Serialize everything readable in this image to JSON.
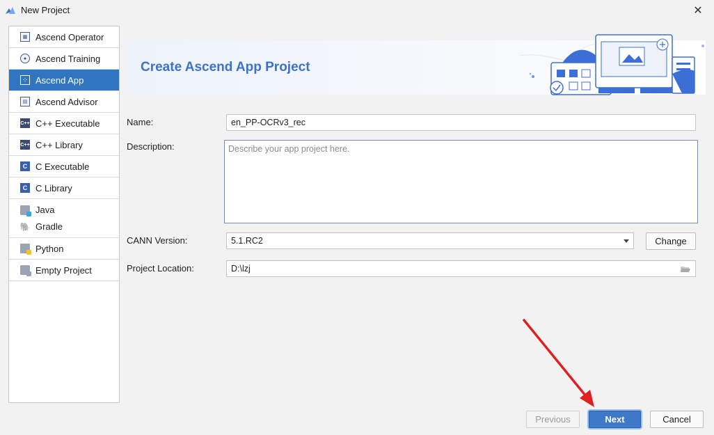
{
  "window": {
    "title": "New Project",
    "close_glyph": "✕"
  },
  "sidebar": {
    "items": [
      {
        "label": "Ascend Operator",
        "icon": "operator-icon",
        "selected": false
      },
      {
        "label": "Ascend Training",
        "icon": "training-icon",
        "selected": false
      },
      {
        "label": "Ascend App",
        "icon": "app-icon",
        "selected": true
      },
      {
        "label": "Ascend Advisor",
        "icon": "advisor-icon",
        "selected": false
      },
      {
        "label": "C++ Executable",
        "icon": "cpp-icon",
        "icon_text": "C++",
        "selected": false
      },
      {
        "label": "C++ Library",
        "icon": "cpp-icon",
        "icon_text": "C++",
        "selected": false
      },
      {
        "label": "C Executable",
        "icon": "c-icon",
        "icon_text": "C",
        "selected": false
      },
      {
        "label": "C Library",
        "icon": "c-icon",
        "icon_text": "C",
        "selected": false
      },
      {
        "label": "Java",
        "icon": "java-icon",
        "selected": false
      },
      {
        "label": "Gradle",
        "icon": "gradle-icon",
        "selected": false
      },
      {
        "label": "Python",
        "icon": "python-icon",
        "selected": false
      },
      {
        "label": "Empty Project",
        "icon": "empty-project-icon",
        "selected": false
      }
    ]
  },
  "banner": {
    "title": "Create Ascend App Project"
  },
  "form": {
    "name_label": "Name:",
    "name_value": "en_PP-OCRv3_rec",
    "description_label": "Description:",
    "description_placeholder": "Describe your app project here.",
    "cann_label": "CANN Version:",
    "cann_value": "5.1.RC2",
    "change_label": "Change",
    "location_label": "Project Location:",
    "location_value": "D:\\lzj"
  },
  "footer": {
    "previous_label": "Previous",
    "next_label": "Next",
    "cancel_label": "Cancel"
  },
  "colors": {
    "accent": "#2f75c0",
    "banner_title": "#3d72c6",
    "annotation_arrow": "#e02020"
  }
}
